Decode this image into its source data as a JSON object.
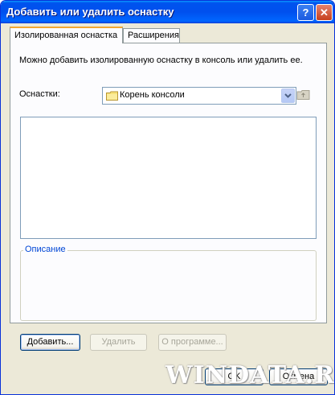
{
  "window": {
    "title": "Добавить или удалить оснастку",
    "help_label": "?",
    "close_label": "✕"
  },
  "tabs": [
    {
      "label": "Изолированная оснастка",
      "active": true
    },
    {
      "label": "Расширения",
      "active": false
    }
  ],
  "panel": {
    "description": "Можно добавить изолированную оснастку в консоль или удалить ее.",
    "snapins_label": "Оснастки:",
    "snapins_value": "Корень консоли",
    "snapins_items": [],
    "description_group_title": "Описание",
    "description_text": ""
  },
  "buttons": {
    "add": "Добавить...",
    "remove": "Удалить",
    "about": "О программе...",
    "ok": "OK",
    "cancel": "Отмена"
  },
  "watermark": "WINDATA.RU",
  "icons": {
    "folder": "folder-icon",
    "dropdown": "chevron-down-icon",
    "up_folder": "folder-up-icon"
  },
  "colors": {
    "titlebar": "#0053ee",
    "window_bg": "#ece9d8",
    "tab_accent": "#f1a732",
    "group_title": "#0046d5"
  }
}
